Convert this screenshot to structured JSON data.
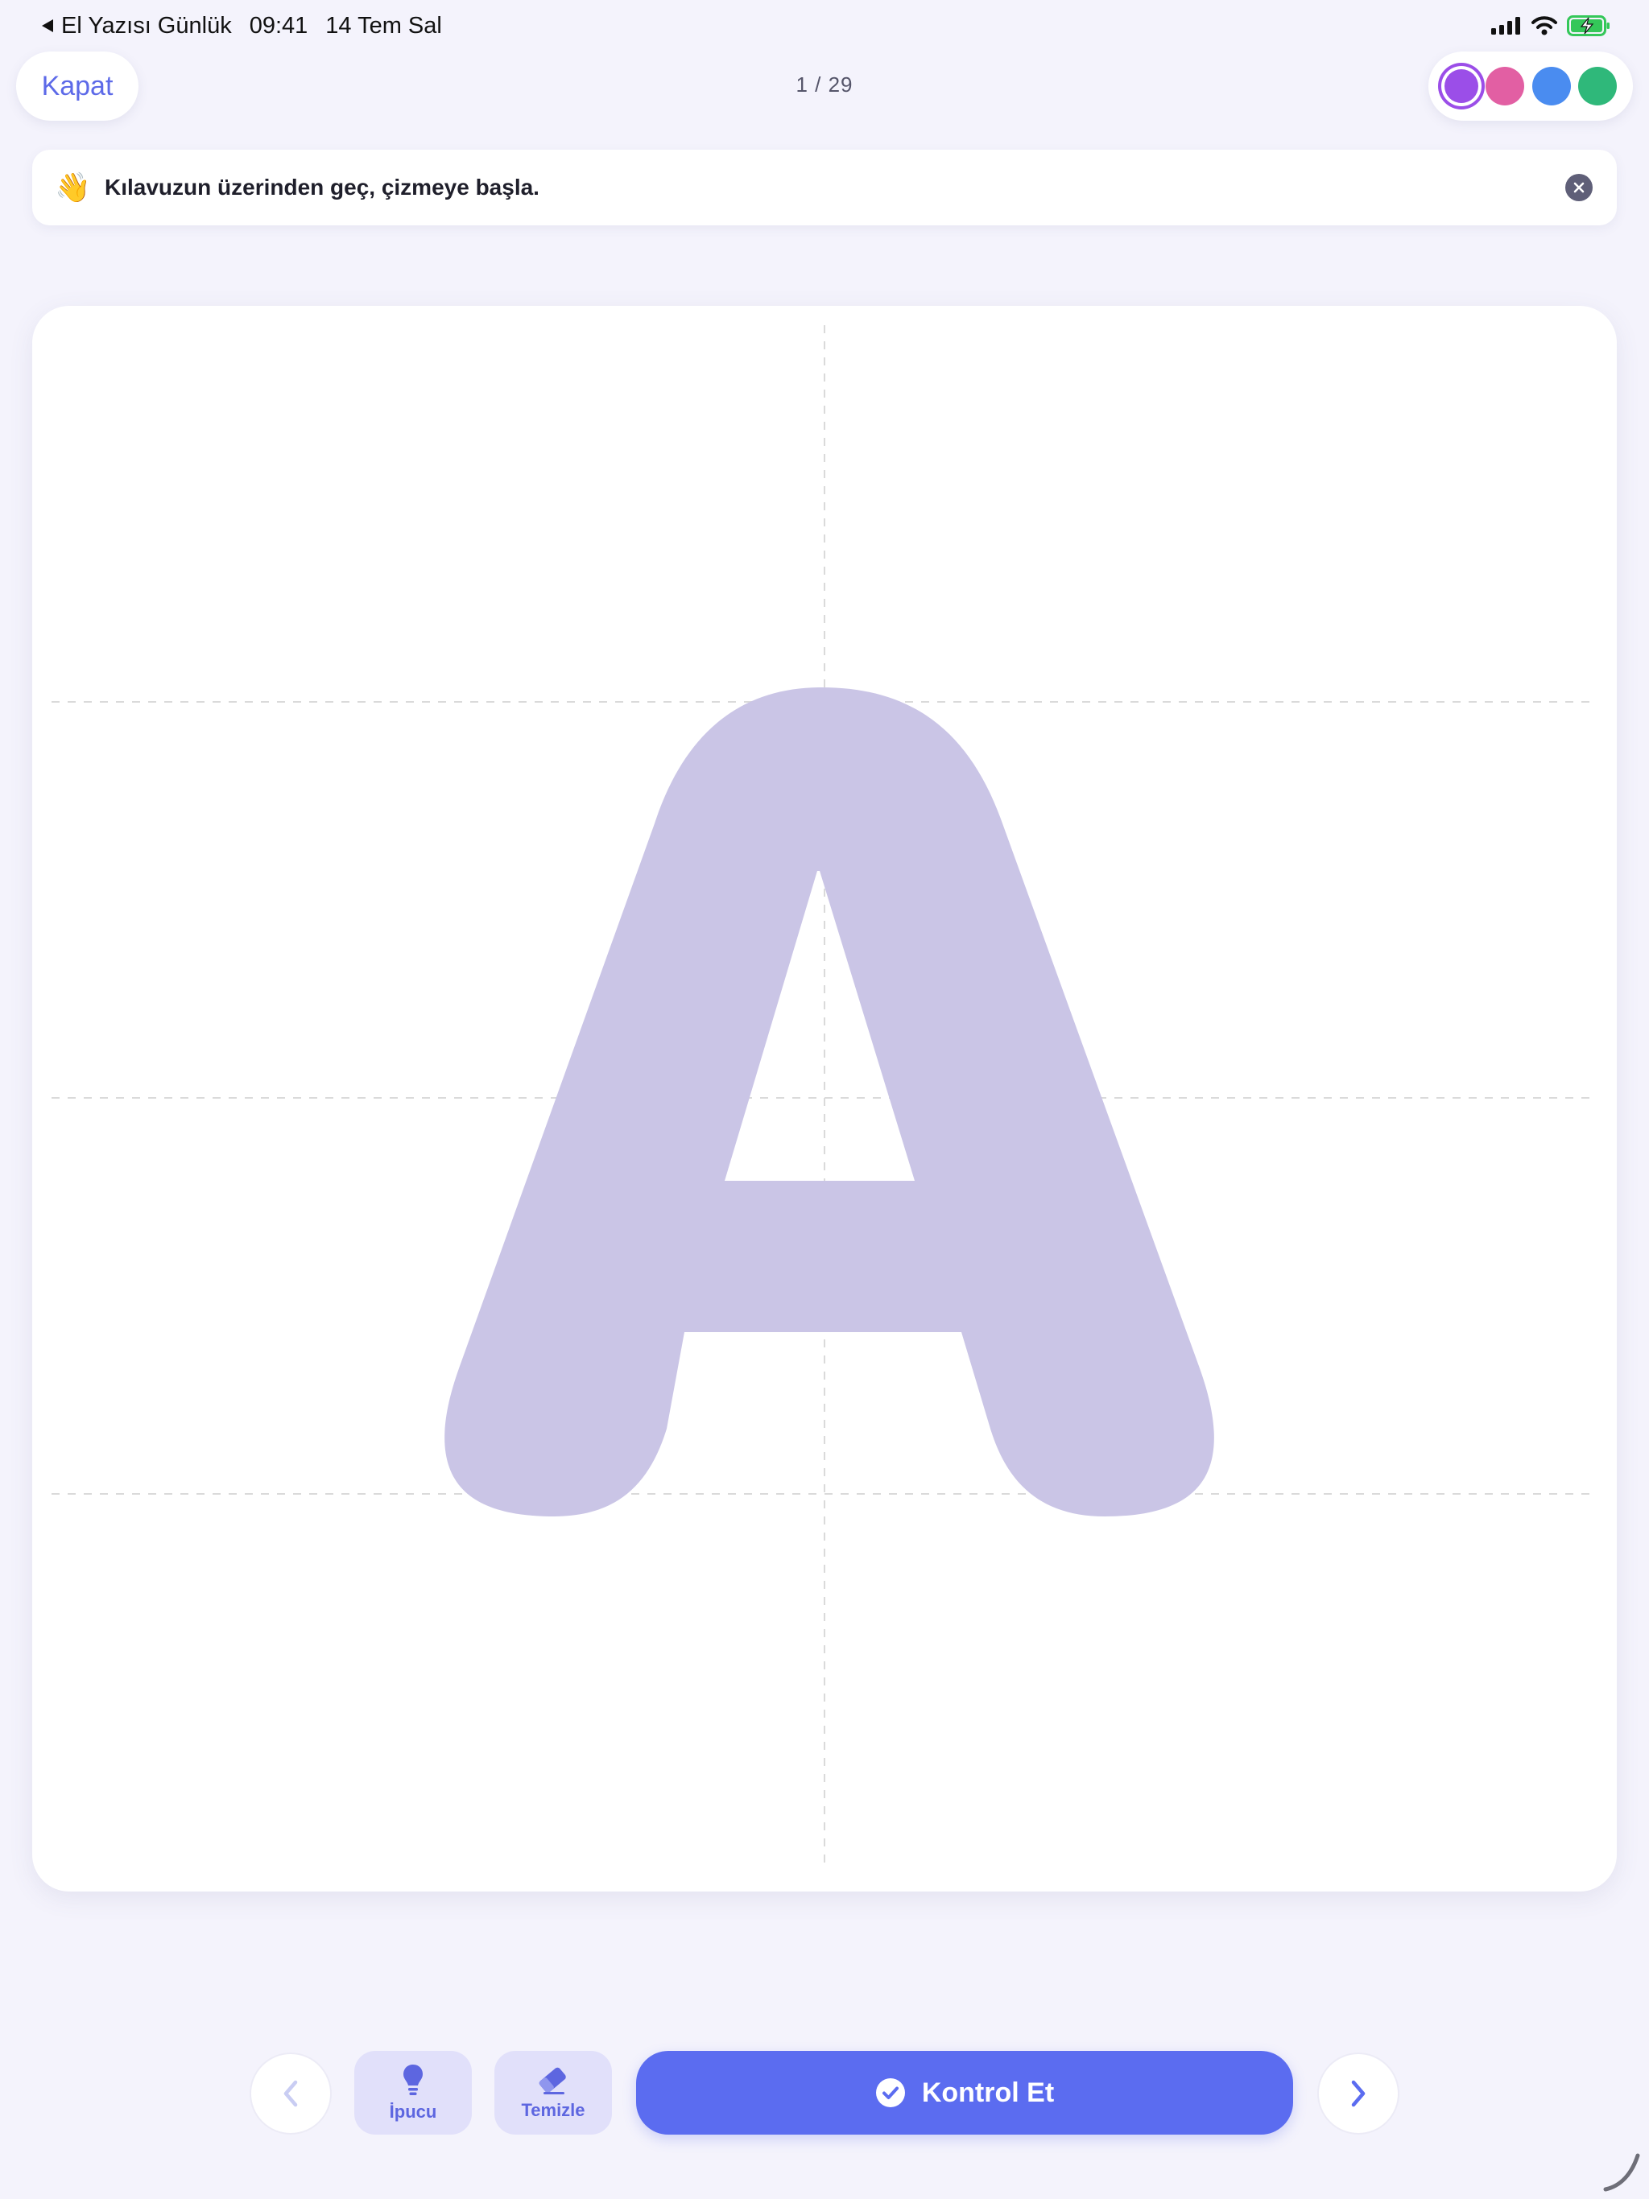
{
  "status_bar": {
    "back_app": "El Yazısı Günlük",
    "time": "09:41",
    "date": "14 Tem Sal"
  },
  "header": {
    "close_label": "Kapat",
    "progress": "1 / 29",
    "palette": {
      "colors": [
        "#9b4ee8",
        "#e25fa3",
        "#4a8cf0",
        "#2fb87a"
      ],
      "selected_index": 0
    }
  },
  "hint": {
    "emoji": "👋",
    "text": "Kılavuzun üzerinden geç, çizmeye başla."
  },
  "canvas": {
    "letter": "A",
    "letter_color": "#cac5e6",
    "guide_color": "#dadada"
  },
  "toolbar": {
    "hint_label": "İpucu",
    "clear_label": "Temizle",
    "check_label": "Kontrol Et",
    "accent": "#5b6cf0"
  }
}
